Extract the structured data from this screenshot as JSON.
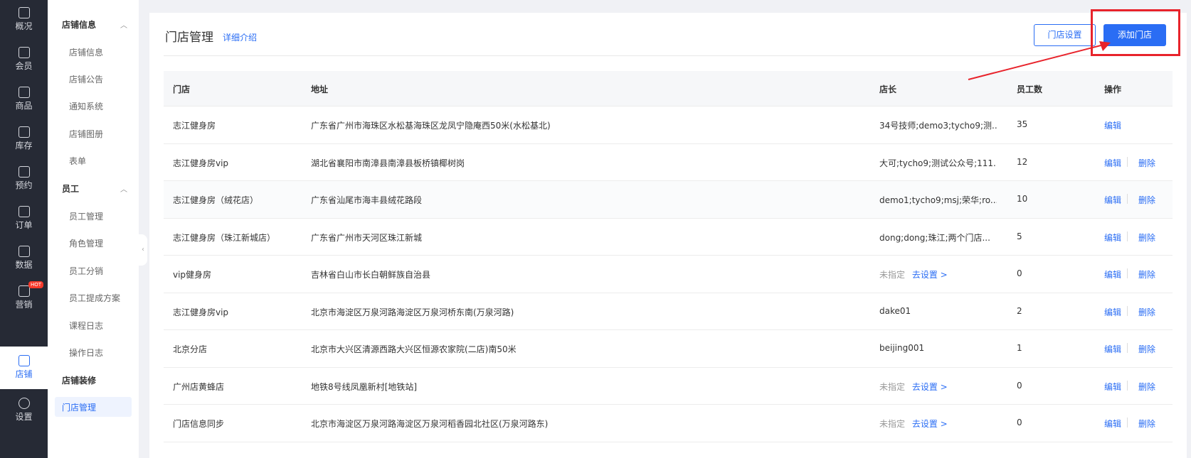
{
  "nav": [
    {
      "label": "概况",
      "icon": "grid-icon"
    },
    {
      "label": "会员",
      "icon": "crown-icon"
    },
    {
      "label": "商品",
      "icon": "store-box-icon"
    },
    {
      "label": "库存",
      "icon": "inventory-icon"
    },
    {
      "label": "预约",
      "icon": "calendar-check-icon"
    },
    {
      "label": "订单",
      "icon": "clipboard-icon"
    },
    {
      "label": "数据",
      "icon": "chart-icon"
    },
    {
      "label": "营销",
      "icon": "gift-icon",
      "badge": "HOT"
    },
    {
      "label": "店铺",
      "icon": "shop-icon"
    },
    {
      "label": "设置",
      "icon": "gear-icon"
    }
  ],
  "submenu": {
    "group1": "店铺信息",
    "group1_items": [
      "店铺信息",
      "店铺公告",
      "通知系统",
      "店铺图册",
      "表单"
    ],
    "group2": "员工",
    "group2_items": [
      "员工管理",
      "角色管理",
      "员工分销",
      "员工提成方案",
      "课程日志",
      "操作日志"
    ],
    "group3": "店铺装修",
    "active": "门店管理"
  },
  "page": {
    "title": "门店管理",
    "detail_link": "详细介绍",
    "setting_button": "门店设置",
    "add_button": "添加门店"
  },
  "table": {
    "headers": [
      "门店",
      "地址",
      "店长",
      "员工数",
      "操作"
    ],
    "rows": [
      {
        "store": "志江健身房",
        "address": "广东省广州市海珠区水松基海珠区龙凤宁隐庵西50米(水松基北)",
        "manager": "34号技师;demo3;tycho9;测...",
        "staff": "35",
        "edit": "编辑",
        "delete": ""
      },
      {
        "store": "志江健身房vip",
        "address": "湖北省襄阳市南漳县南漳县板桥镇椰树岗",
        "manager": "大可;tycho9;测试公众号;111...",
        "staff": "12",
        "edit": "编辑",
        "delete": "删除"
      },
      {
        "store": "志江健身房（绒花店）",
        "address": "广东省汕尾市海丰县绒花路段",
        "manager": "demo1;tycho9;msj;荣华;ro...",
        "staff": "10",
        "edit": "编辑",
        "delete": "删除"
      },
      {
        "store": "志江健身房（珠江新城店）",
        "address": "广东省广州市天河区珠江新城",
        "manager": "dong;dong;珠江;两个门店...",
        "staff": "5",
        "edit": "编辑",
        "delete": "删除"
      },
      {
        "store": "vip健身房",
        "address": "吉林省白山市长白朝鲜族自治县",
        "manager": "",
        "unassigned": "未指定",
        "go_set": "去设置 >",
        "staff": "0",
        "edit": "编辑",
        "delete": "删除"
      },
      {
        "store": "志江健身房vip",
        "address": "北京市海淀区万泉河路海淀区万泉河桥东南(万泉河路)",
        "manager": "dake01",
        "staff": "2",
        "edit": "编辑",
        "delete": "删除"
      },
      {
        "store": "北京分店",
        "address": "北京市大兴区清源西路大兴区恒源农家院(二店)南50米",
        "manager": "beijing001",
        "staff": "1",
        "edit": "编辑",
        "delete": "删除"
      },
      {
        "store": "广州店黄蜂店",
        "address": "地铁8号线凤凰新村[地铁站]",
        "manager": "",
        "unassigned": "未指定",
        "go_set": "去设置 >",
        "staff": "0",
        "edit": "编辑",
        "delete": "删除"
      },
      {
        "store": "门店信息同步",
        "address": "北京市海淀区万泉河路海淀区万泉河稻香园北社区(万泉河路东)",
        "manager": "",
        "unassigned": "未指定",
        "go_set": "去设置 >",
        "staff": "0",
        "edit": "编辑",
        "delete": "删除"
      }
    ]
  },
  "colors": {
    "accent": "#2a6df4",
    "nav_bg": "#262a35",
    "highlight": "#e8232b"
  }
}
